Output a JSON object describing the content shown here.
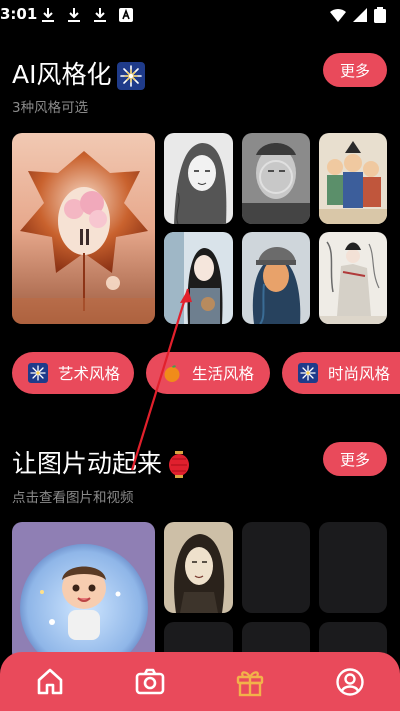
{
  "status_bar": {
    "time": "3:01",
    "icons": [
      "download-icon",
      "download-icon",
      "download-icon",
      "font-a-icon",
      "wifi-icon",
      "signal-icon",
      "battery-icon"
    ]
  },
  "section_ai": {
    "title": "AI风格化",
    "title_emoji": "sparkle-firework-icon",
    "subtitle": "3种风格可选",
    "more_label": "更多"
  },
  "style_chips": [
    {
      "label": "艺术风格",
      "icon": "sparkle-firework-icon"
    },
    {
      "label": "生活风格",
      "icon": "orange-fruit-icon"
    },
    {
      "label": "时尚风格",
      "icon": "sparkle-firework-icon"
    }
  ],
  "section_animate": {
    "title": "让图片动起来",
    "title_emoji": "red-lantern-icon",
    "subtitle": "点击查看图片和视频",
    "more_label": "更多"
  },
  "bottom_nav": {
    "items": [
      "home-icon",
      "camera-icon",
      "gift-icon",
      "profile-icon"
    ],
    "active": "gift-icon"
  },
  "colors": {
    "accent": "#e94a5b",
    "background": "#000000",
    "subtitle": "#8a8a8a",
    "gift_active": "#f2b24a"
  }
}
